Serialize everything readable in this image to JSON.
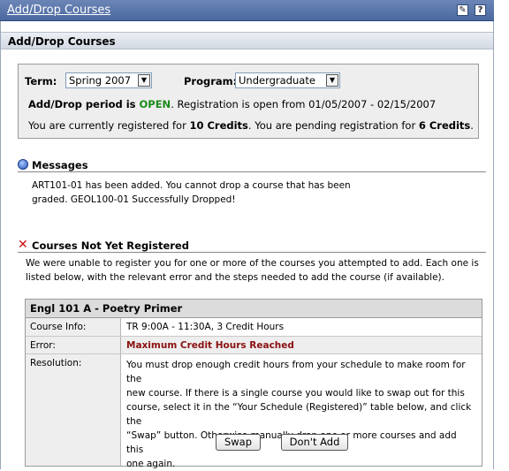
{
  "window": {
    "title": "Add/Drop Courses",
    "icons": [
      "tools-icon",
      "help-icon"
    ],
    "help_glyph": "?"
  },
  "section": {
    "title": "Add/Drop Courses"
  },
  "term": {
    "label": "Term:",
    "selected": "Spring 2007"
  },
  "program": {
    "label": "Program:",
    "selected": "Undergraduate"
  },
  "period": {
    "prefix": "Add/Drop period is ",
    "status": "OPEN",
    "suffix": ". Registration is open from 01/05/2007 - 02/15/2007"
  },
  "credits": {
    "prefix": "You are currently registered for ",
    "registered": "10 Credits",
    "middle": ". You are pending registration for ",
    "pending": "6 Credits",
    "suffix": "."
  },
  "messages": {
    "heading": "Messages",
    "line1": "ART101-01 has been added. You cannot drop a course that has been",
    "line2": "graded. GEOL100-01 Successfully Dropped!"
  },
  "not_registered": {
    "heading": "Courses Not Yet Registered",
    "line1": "We were unable to register you for one or more of the courses you attempted to add. Each one is",
    "line2": "listed below, with the relevant error and the steps needed to add the course (if available)."
  },
  "course": {
    "title": "Engl 101 A - Poetry Primer",
    "info_label": "Course Info:",
    "info_value": "TR 9:00A - 11:30A, 3 Credit Hours",
    "error_label": "Error:",
    "error_value": "Maximum Credit Hours Reached",
    "resolution_label": "Resolution:",
    "resolution_lines": [
      "You must drop enough credit hours from your schedule to make room for the",
      "new course. If there is a single course you would like to swap out for this",
      "course, select it in the “Your Schedule (Registered)” table below, and click the",
      "“Swap” button. Otherwise manually drop one or more courses and add this",
      "one again."
    ],
    "swap_button": "Swap",
    "dont_add_button": "Don't Add"
  },
  "colors": {
    "open": "#1a8a1a",
    "error": "#8a1010",
    "titlebar": "#5a76aa"
  }
}
